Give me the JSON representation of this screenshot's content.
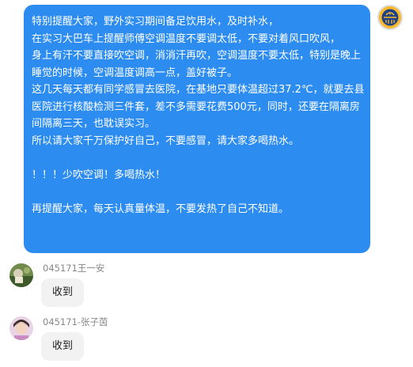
{
  "outgoing_message": {
    "lines": [
      "特别提醒大家，野外实习期间备足饮用水，及时补水，",
      "在实习大巴车上提醒师傅空调温度不要调太低，不要对着风口吹风，",
      "身上有汗不要直接吹空调，消消汗再吹，空调温度不要太低，特别是晚上",
      "睡觉的时候，空调温度调高一点，盖好被子。",
      "这几天每天都有同学感冒去医院，在基地只要体温超过37.2℃，就要去县",
      "医院进行核酸检测三件套，差不多需要花费500元，同时，还要在隔离房",
      "间隔离三天，也耽误实习。",
      "所以请大家千万保护好自己，不要感冒，请大家多喝热水。",
      "",
      "！！！少吹空调！多喝热水！",
      "",
      "再提醒大家，每天认真量体温，不要发热了自己不知道。"
    ]
  },
  "incoming_messages": [
    {
      "sender": "045171王一安",
      "text": "收到"
    },
    {
      "sender": "045171-张子茵",
      "text": "收到"
    }
  ],
  "colors": {
    "outgoing_bubble": "#2d8cf0",
    "incoming_bubble": "#f2f2f2",
    "sender_name": "#888888"
  },
  "icons": {
    "self_avatar": "warriors-logo-avatar",
    "user1_avatar": "photo-avatar",
    "user2_avatar": "photo-avatar"
  }
}
